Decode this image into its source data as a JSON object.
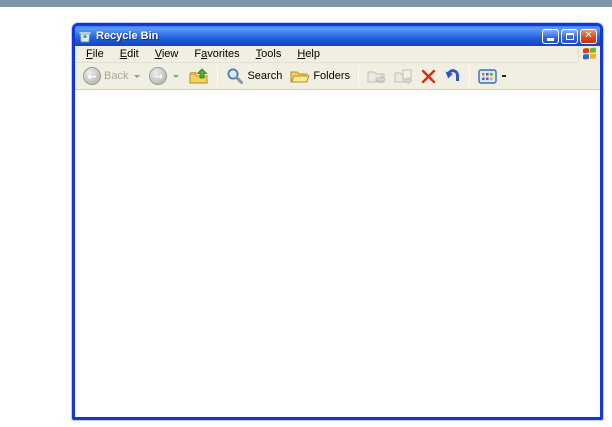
{
  "page": {
    "background": "#ffffff",
    "top_stripe_color": "#7e96ac"
  },
  "window": {
    "title": "Recycle Bin",
    "titlebar": {
      "icon": "recycle-bin-icon",
      "controls": [
        {
          "name": "minimize"
        },
        {
          "name": "maximize"
        },
        {
          "name": "close"
        }
      ]
    },
    "menubar": {
      "items": [
        {
          "label": "File",
          "accel_index": 0
        },
        {
          "label": "Edit",
          "accel_index": 0
        },
        {
          "label": "View",
          "accel_index": 0
        },
        {
          "label": "Favorites",
          "accel_index": 1
        },
        {
          "label": "Tools",
          "accel_index": 0
        },
        {
          "label": "Help",
          "accel_index": 0
        }
      ],
      "logo": "windows-flag-icon"
    },
    "toolbar": {
      "back": {
        "label": "Back",
        "enabled": false,
        "dropdown": true
      },
      "forward": {
        "enabled": false,
        "dropdown": true
      },
      "up": {
        "enabled": true
      },
      "search": {
        "label": "Search",
        "enabled": true
      },
      "folders": {
        "label": "Folders",
        "enabled": true
      },
      "move_to": {
        "enabled": false
      },
      "copy_to": {
        "enabled": false
      },
      "delete": {
        "enabled": true
      },
      "undo": {
        "enabled": true
      },
      "views": {
        "enabled": true,
        "dropdown": true
      }
    },
    "content": {
      "items": []
    }
  },
  "colors": {
    "window_border": "#1437d8",
    "titlebar_gradient_top": "#3c86f2",
    "titlebar_gradient_bottom": "#1345b4",
    "chrome_background": "#f1efe2",
    "close_button": "#dc4826",
    "delete_x": "#e02818",
    "undo_arrow": "#2f55cc",
    "folder_yellow": "#f2c03c"
  }
}
